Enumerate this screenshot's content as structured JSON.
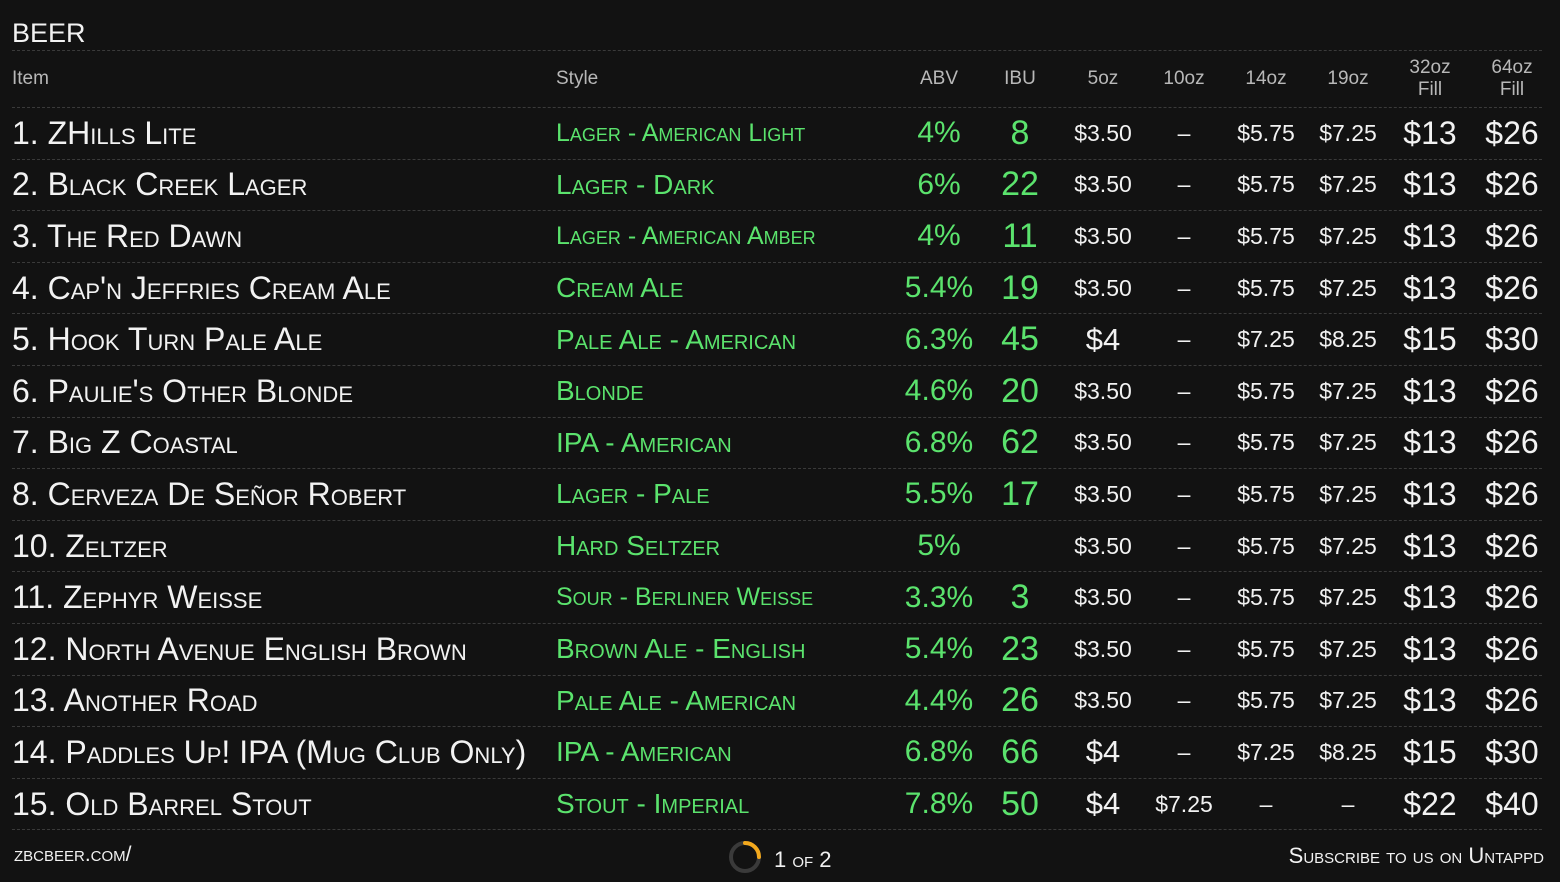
{
  "section_title": "BEER",
  "headers": {
    "item": "Item",
    "style": "Style",
    "abv": "ABV",
    "ibu": "IBU",
    "oz5": "5oz",
    "oz10": "10oz",
    "oz14": "14oz",
    "oz19": "19oz",
    "oz32_line1": "32oz",
    "oz32_line2": "Fill",
    "oz64_line1": "64oz",
    "oz64_line2": "Fill"
  },
  "beers": [
    {
      "name": "1. ZHills Lite",
      "style": "Lager - American Light",
      "abv": "4%",
      "ibu": "8",
      "p5": "$3.50",
      "p10": "–",
      "p14": "$5.75",
      "p19": "$7.25",
      "p32": "$13",
      "p64": "$26"
    },
    {
      "name": "2. Black Creek Lager",
      "style": "Lager - Dark",
      "abv": "6%",
      "ibu": "22",
      "p5": "$3.50",
      "p10": "–",
      "p14": "$5.75",
      "p19": "$7.25",
      "p32": "$13",
      "p64": "$26"
    },
    {
      "name": "3. The Red Dawn",
      "style": "Lager - American Amber",
      "abv": "4%",
      "ibu": "11",
      "p5": "$3.50",
      "p10": "–",
      "p14": "$5.75",
      "p19": "$7.25",
      "p32": "$13",
      "p64": "$26"
    },
    {
      "name": "4. Cap'n Jeffries Cream Ale",
      "style": "Cream Ale",
      "abv": "5.4%",
      "ibu": "19",
      "p5": "$3.50",
      "p10": "–",
      "p14": "$5.75",
      "p19": "$7.25",
      "p32": "$13",
      "p64": "$26"
    },
    {
      "name": "5. Hook Turn Pale Ale",
      "style": "Pale Ale - American",
      "abv": "6.3%",
      "ibu": "45",
      "p5": "$4",
      "p10": "–",
      "p14": "$7.25",
      "p19": "$8.25",
      "p32": "$15",
      "p64": "$30"
    },
    {
      "name": "6. Paulie's Other Blonde",
      "style": "Blonde",
      "abv": "4.6%",
      "ibu": "20",
      "p5": "$3.50",
      "p10": "–",
      "p14": "$5.75",
      "p19": "$7.25",
      "p32": "$13",
      "p64": "$26"
    },
    {
      "name": "7. Big Z Coastal",
      "style": "IPA - American",
      "abv": "6.8%",
      "ibu": "62",
      "p5": "$3.50",
      "p10": "–",
      "p14": "$5.75",
      "p19": "$7.25",
      "p32": "$13",
      "p64": "$26"
    },
    {
      "name": "8. Cerveza De Señor Robert",
      "style": "Lager - Pale",
      "abv": "5.5%",
      "ibu": "17",
      "p5": "$3.50",
      "p10": "–",
      "p14": "$5.75",
      "p19": "$7.25",
      "p32": "$13",
      "p64": "$26"
    },
    {
      "name": "10. Zeltzer",
      "style": "Hard Seltzer",
      "abv": "5%",
      "ibu": "",
      "p5": "$3.50",
      "p10": "–",
      "p14": "$5.75",
      "p19": "$7.25",
      "p32": "$13",
      "p64": "$26"
    },
    {
      "name": "11. Zephyr Weisse",
      "style": "Sour - Berliner Weisse",
      "abv": "3.3%",
      "ibu": "3",
      "p5": "$3.50",
      "p10": "–",
      "p14": "$5.75",
      "p19": "$7.25",
      "p32": "$13",
      "p64": "$26"
    },
    {
      "name": "12. North Avenue English Brown",
      "style": "Brown Ale - English",
      "abv": "5.4%",
      "ibu": "23",
      "p5": "$3.50",
      "p10": "–",
      "p14": "$5.75",
      "p19": "$7.25",
      "p32": "$13",
      "p64": "$26"
    },
    {
      "name": "13. Another Road",
      "style": "Pale Ale - American",
      "abv": "4.4%",
      "ibu": "26",
      "p5": "$3.50",
      "p10": "–",
      "p14": "$5.75",
      "p19": "$7.25",
      "p32": "$13",
      "p64": "$26"
    },
    {
      "name": "14. Paddles Up! IPA (Mug Club Only)",
      "style": "IPA - American",
      "abv": "6.8%",
      "ibu": "66",
      "p5": "$4",
      "p10": "–",
      "p14": "$7.25",
      "p19": "$8.25",
      "p32": "$15",
      "p64": "$30"
    },
    {
      "name": "15. Old Barrel Stout",
      "style": "Stout - Imperial",
      "abv": "7.8%",
      "ibu": "50",
      "p5": "$4",
      "p10": "$7.25",
      "p14": "–",
      "p19": "–",
      "p32": "$22",
      "p64": "$40"
    }
  ],
  "footer": {
    "website": "zbcbeer.com/",
    "page_indicator": "1 of 2",
    "subscribe_text": "Subscribe to us on",
    "subscribe_brand": "Untappd"
  },
  "colors": {
    "background": "#121212",
    "accent_green": "#5be36d",
    "text": "#f2f2f2",
    "loader_ring": "#f2a81d"
  }
}
